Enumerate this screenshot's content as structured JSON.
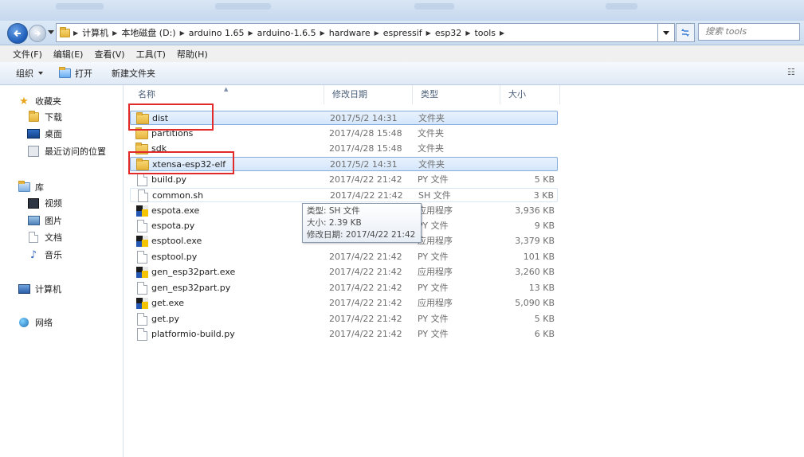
{
  "address": {
    "breadcrumbs": [
      "计算机",
      "本地磁盘 (D:)",
      "arduino 1.65",
      "arduino-1.6.5",
      "hardware",
      "espressif",
      "esp32",
      "tools"
    ],
    "search_placeholder": "搜索 tools"
  },
  "menu": [
    "文件(F)",
    "编辑(E)",
    "查看(V)",
    "工具(T)",
    "帮助(H)"
  ],
  "toolbar": {
    "organize": "组织",
    "open": "打开",
    "new_folder": "新建文件夹"
  },
  "nav": {
    "favorites": "收藏夹",
    "downloads": "下载",
    "desktop": "桌面",
    "recent": "最近访问的位置",
    "libraries": "库",
    "videos": "视频",
    "pictures": "图片",
    "documents": "文档",
    "music": "音乐",
    "computer": "计算机",
    "network": "网络"
  },
  "columns": {
    "name": "名称",
    "date": "修改日期",
    "type": "类型",
    "size": "大小"
  },
  "files": [
    {
      "name": "dist",
      "date": "2017/5/2 14:31",
      "type": "文件夹",
      "size": "",
      "icon": "folder"
    },
    {
      "name": "partitions",
      "date": "2017/4/28 15:48",
      "type": "文件夹",
      "size": "",
      "icon": "folder"
    },
    {
      "name": "sdk",
      "date": "2017/4/28 15:48",
      "type": "文件夹",
      "size": "",
      "icon": "folder"
    },
    {
      "name": "xtensa-esp32-elf",
      "date": "2017/5/2 14:31",
      "type": "文件夹",
      "size": "",
      "icon": "folder"
    },
    {
      "name": "build.py",
      "date": "2017/4/22 21:42",
      "type": "PY 文件",
      "size": "5 KB",
      "icon": "file"
    },
    {
      "name": "common.sh",
      "date": "2017/4/22 21:42",
      "type": "SH 文件",
      "size": "3 KB",
      "icon": "file"
    },
    {
      "name": "espota.exe",
      "date": "",
      "type": "应用程序",
      "size": "3,936 KB",
      "icon": "exe"
    },
    {
      "name": "espota.py",
      "date": "",
      "type": "PY 文件",
      "size": "9 KB",
      "icon": "file"
    },
    {
      "name": "esptool.exe",
      "date": "",
      "type": "应用程序",
      "size": "3,379 KB",
      "icon": "exe"
    },
    {
      "name": "esptool.py",
      "date": "2017/4/22 21:42",
      "type": "PY 文件",
      "size": "101 KB",
      "icon": "file"
    },
    {
      "name": "gen_esp32part.exe",
      "date": "2017/4/22 21:42",
      "type": "应用程序",
      "size": "3,260 KB",
      "icon": "exe"
    },
    {
      "name": "gen_esp32part.py",
      "date": "2017/4/22 21:42",
      "type": "PY 文件",
      "size": "13 KB",
      "icon": "file"
    },
    {
      "name": "get.exe",
      "date": "2017/4/22 21:42",
      "type": "应用程序",
      "size": "5,090 KB",
      "icon": "exe"
    },
    {
      "name": "get.py",
      "date": "2017/4/22 21:42",
      "type": "PY 文件",
      "size": "5 KB",
      "icon": "file"
    },
    {
      "name": "platformio-build.py",
      "date": "2017/4/22 21:42",
      "type": "PY 文件",
      "size": "6 KB",
      "icon": "file"
    }
  ],
  "tooltip": {
    "type_line": "类型: SH 文件",
    "size_line": "大小: 2.39 KB",
    "date_line": "修改日期: 2017/4/22 21:42"
  }
}
